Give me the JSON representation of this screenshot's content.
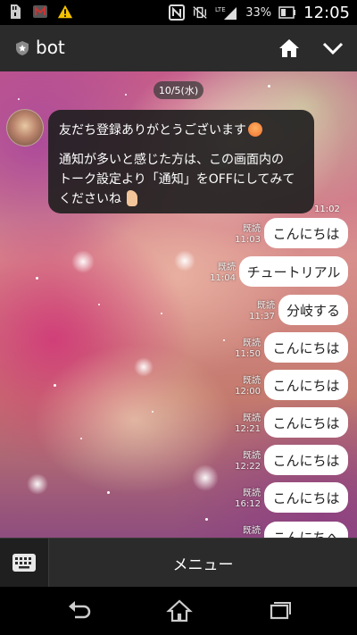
{
  "status_bar": {
    "icons_left": [
      "sd-card-icon",
      "app-badge-icon",
      "warning-icon"
    ],
    "icons_right": [
      "nfc-icon",
      "vibrate-off-icon",
      "lte-signal-icon"
    ],
    "network": "LTE",
    "battery_percent": "33%",
    "time": "12:05"
  },
  "header": {
    "title": "bot",
    "badge_icon": "star-badge-icon",
    "home_icon": "home-icon",
    "collapse_icon": "chevron-down-icon"
  },
  "chat": {
    "date": "10/5(水)",
    "bot_message": {
      "line1": "友だち登録ありがとうございます",
      "line2": "通知が多いと感じた方は、この画面内の",
      "line3": "トーク設定より「通知」をOFFにしてみて",
      "line4": "くださいね",
      "time": "11:02",
      "emoji1": "smiling-face-icon",
      "emoji2": "thumbs-up-icon"
    },
    "user_messages": [
      {
        "read": "既読",
        "time": "11:03",
        "text": "こんにちは"
      },
      {
        "read": "既読",
        "time": "11:04",
        "text": "チュートリアル"
      },
      {
        "read": "既読",
        "time": "11:37",
        "text": "分岐する"
      },
      {
        "read": "既読",
        "time": "11:50",
        "text": "こんにちは"
      },
      {
        "read": "既読",
        "time": "12:00",
        "text": "こんにちは"
      },
      {
        "read": "既読",
        "time": "12:21",
        "text": "こんにちは"
      },
      {
        "read": "既読",
        "time": "12:22",
        "text": "こんにちは"
      },
      {
        "read": "既読",
        "time": "16:12",
        "text": "こんにちは"
      },
      {
        "read": "既読",
        "time": "",
        "text": "こんにちへ"
      }
    ]
  },
  "bottom_bar": {
    "keyboard_icon": "keyboard-icon",
    "menu_label": "メニュー"
  },
  "nav_bar": {
    "back_icon": "back-icon",
    "home_icon": "home-outline-icon",
    "recents_icon": "recent-apps-icon"
  }
}
